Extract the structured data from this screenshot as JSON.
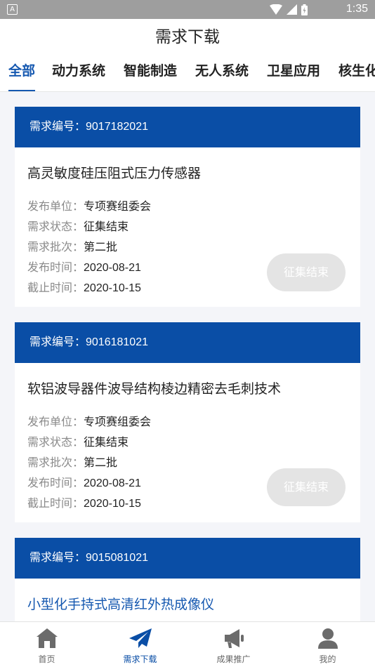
{
  "status_bar": {
    "app_badge": "A",
    "time": "1:35"
  },
  "header": {
    "title": "需求下载"
  },
  "tabs": [
    {
      "label": "全部"
    },
    {
      "label": "动力系统"
    },
    {
      "label": "智能制造"
    },
    {
      "label": "无人系统"
    },
    {
      "label": "卫星应用"
    },
    {
      "label": "核生化"
    }
  ],
  "cards": [
    {
      "id_label": "需求编号：9017182021",
      "title": "高灵敏度硅压阻式压力传感器",
      "fields": [
        {
          "key": "发布单位：",
          "value": "专项赛组委会"
        },
        {
          "key": "需求状态：",
          "value": "征集结束"
        },
        {
          "key": "需求批次：",
          "value": "第二批"
        },
        {
          "key": "发布时间：",
          "value": "2020-08-21"
        },
        {
          "key": "截止时间：",
          "value": "2020-10-15"
        }
      ],
      "button": "征集结束"
    },
    {
      "id_label": "需求编号：9016181021",
      "title": "软铝波导器件波导结构棱边精密去毛刺技术",
      "fields": [
        {
          "key": "发布单位：",
          "value": "专项赛组委会"
        },
        {
          "key": "需求状态：",
          "value": "征集结束"
        },
        {
          "key": "需求批次：",
          "value": "第二批"
        },
        {
          "key": "发布时间：",
          "value": "2020-08-21"
        },
        {
          "key": "截止时间：",
          "value": "2020-10-15"
        }
      ],
      "button": "征集结束"
    },
    {
      "id_label": "需求编号：9015081021",
      "title": "小型化手持式高清红外热成像仪"
    }
  ],
  "tabbar": [
    {
      "label": "首页",
      "icon": "home-icon"
    },
    {
      "label": "需求下载",
      "icon": "paper-plane-icon"
    },
    {
      "label": "成果推广",
      "icon": "megaphone-icon"
    },
    {
      "label": "我的",
      "icon": "user-icon"
    }
  ],
  "colors": {
    "primary": "#0a4ea6",
    "accent": "#1558b0",
    "disabled_button": "#e4e4e4",
    "background": "#f4f5f9"
  }
}
